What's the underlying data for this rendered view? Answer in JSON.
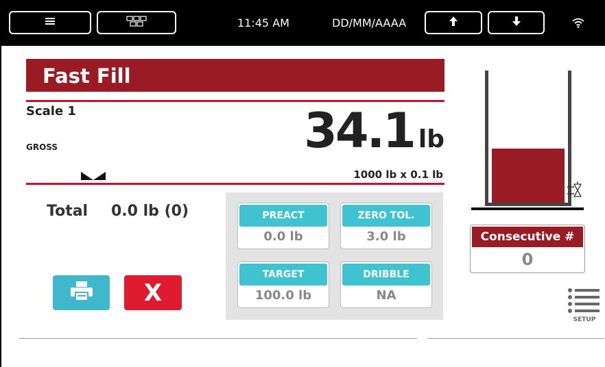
{
  "topbar": {
    "menu_icon": "hamburger-icon",
    "grid_icon": "grid-icon",
    "time": "11:45 AM",
    "date": "DD/MM/AAAA",
    "up_icon": "arrow-up-icon",
    "down_icon": "arrow-down-icon",
    "wifi_icon": "wifi-icon"
  },
  "title": "Fast Fill",
  "scale": {
    "name": "Scale 1",
    "mode": "GROSS",
    "weight": "34.1",
    "unit": "lb",
    "capacity": "1000 lb x 0.1 lb"
  },
  "total": {
    "label": "Total",
    "value": "0.0 lb (0)"
  },
  "buttons": {
    "print_icon": "printer-icon",
    "cancel_label": "X"
  },
  "params": [
    {
      "label": "PREACT",
      "value": "0.0 lb"
    },
    {
      "label": "ZERO TOL.",
      "value": "3.0 lb"
    },
    {
      "label": "TARGET",
      "value": "100.0 lb"
    },
    {
      "label": "DRIBBLE",
      "value": "NA"
    }
  ],
  "tank": {
    "fill_fraction": 0.42
  },
  "consecutive": {
    "label": "Consecutive #",
    "value": "0"
  },
  "setup": {
    "label": "SETUP",
    "icon": "list-menu-icon"
  },
  "colors": {
    "brand_red": "#9b1b25",
    "accent_red": "#c8102e",
    "cancel_red": "#e01b2f",
    "cyan": "#3fc3d1",
    "panel_gray": "#e3e3e3"
  }
}
